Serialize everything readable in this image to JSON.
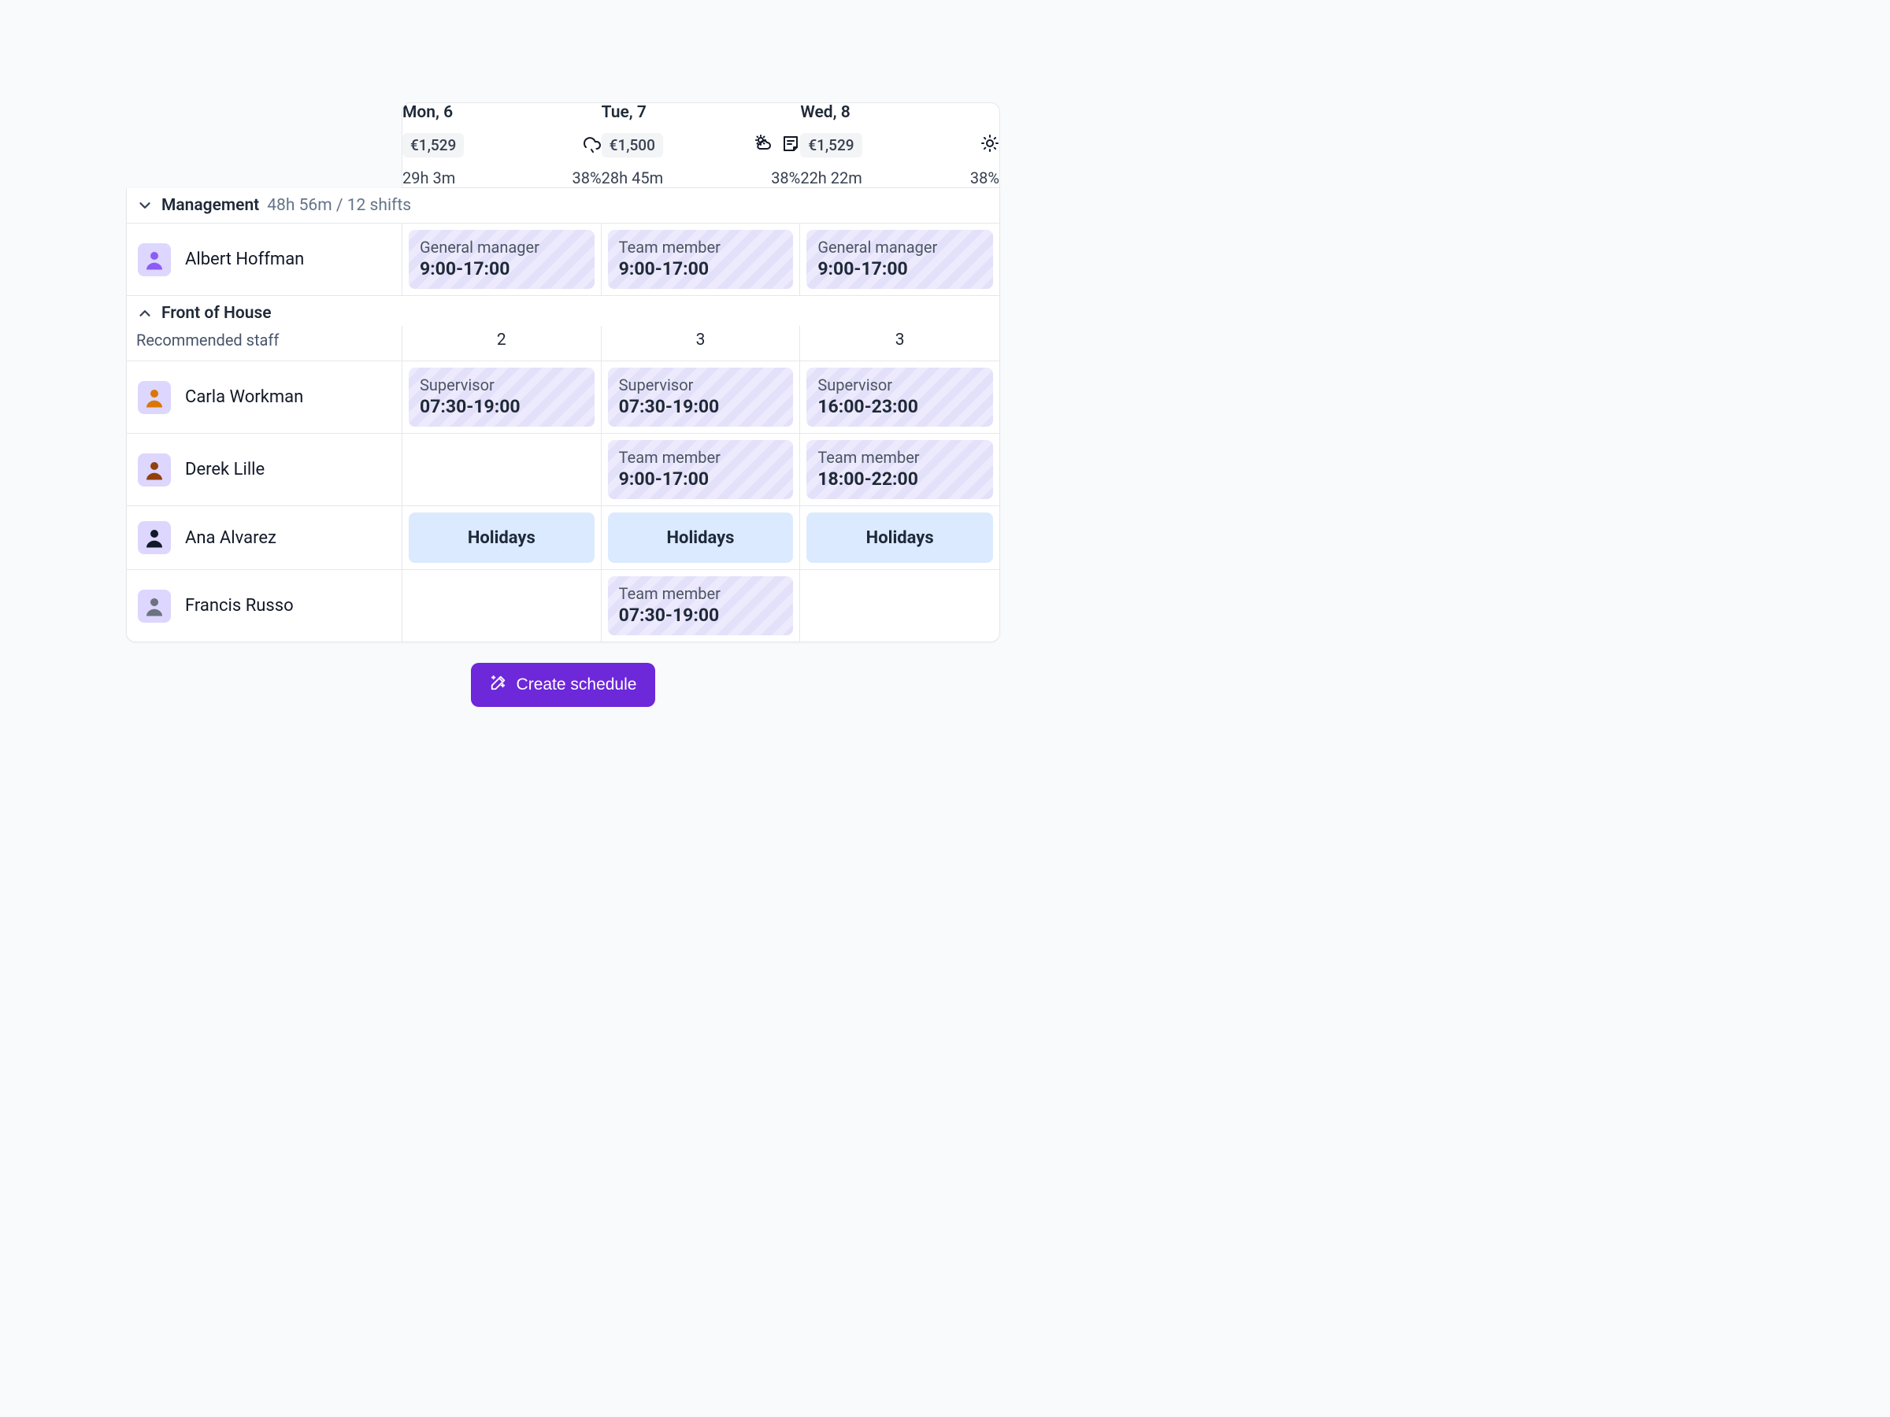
{
  "days": [
    {
      "label": "Mon, 6",
      "sales": "€1,529",
      "hours": "29h 3m",
      "pct": "38%",
      "weather": "rain"
    },
    {
      "label": "Tue, 7",
      "sales": "€1,500",
      "hours": "28h 45m",
      "pct": "38%",
      "weather": "partly",
      "note": true
    },
    {
      "label": "Wed, 8",
      "sales": "€1,529",
      "hours": "22h 22m",
      "pct": "38%",
      "weather": "sun"
    }
  ],
  "groups": {
    "management": {
      "title": "Management",
      "meta": "48h 56m / 12 shifts"
    },
    "foh": {
      "title": "Front of House",
      "rec_label": "Recommended staff",
      "recommended": [
        "2",
        "3",
        "3"
      ]
    }
  },
  "employees": {
    "albert": {
      "name": "Albert Hoffman",
      "shifts": [
        {
          "role": "General manager",
          "time": "9:00-17:00"
        },
        {
          "role": "Team member",
          "time": "9:00-17:00"
        },
        {
          "role": "General manager",
          "time": "9:00-17:00"
        }
      ]
    },
    "carla": {
      "name": "Carla Workman",
      "shifts": [
        {
          "role": "Supervisor",
          "time": "07:30-19:00"
        },
        {
          "role": "Supervisor",
          "time": "07:30-19:00"
        },
        {
          "role": "Supervisor",
          "time": "16:00-23:00"
        }
      ]
    },
    "derek": {
      "name": "Derek Lille",
      "shifts": [
        null,
        {
          "role": "Team member",
          "time": "9:00-17:00"
        },
        {
          "role": "Team member",
          "time": "18:00-22:00"
        }
      ]
    },
    "ana": {
      "name": "Ana Alvarez",
      "holiday_label": "Holidays"
    },
    "francis": {
      "name": "Francis Russo",
      "shifts": [
        null,
        {
          "role": "Team member",
          "time": "07:30-19:00"
        },
        null
      ]
    }
  },
  "cta": {
    "label": "Create schedule"
  }
}
